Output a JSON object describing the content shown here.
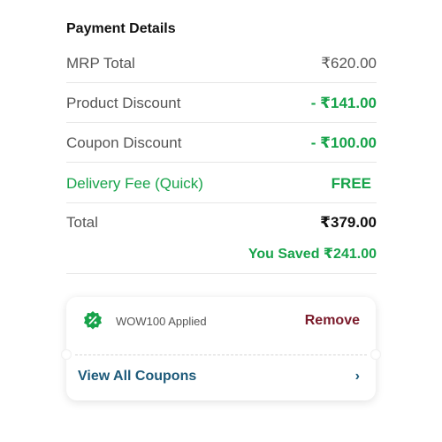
{
  "payment": {
    "title": "Payment Details",
    "mrp": {
      "label": "MRP Total",
      "value": "₹620.00"
    },
    "product_discount": {
      "label": "Product Discount",
      "value": "- ₹141.00"
    },
    "coupon_discount": {
      "label": "Coupon Discount",
      "value": "- ₹100.00"
    },
    "delivery": {
      "label": "Delivery Fee (Quick)",
      "value": "FREE"
    },
    "total": {
      "label": "Total",
      "value": "₹379.00"
    },
    "saved": "You Saved ₹241.00"
  },
  "coupon": {
    "applied_text": "WOW100 Applied",
    "remove_label": "Remove",
    "view_all_label": "View All Coupons",
    "icon": "discount-badge-icon",
    "chevron": "›"
  },
  "colors": {
    "green": "#17a34a",
    "remove": "#7a1a2a",
    "link": "#1d5a7a"
  }
}
